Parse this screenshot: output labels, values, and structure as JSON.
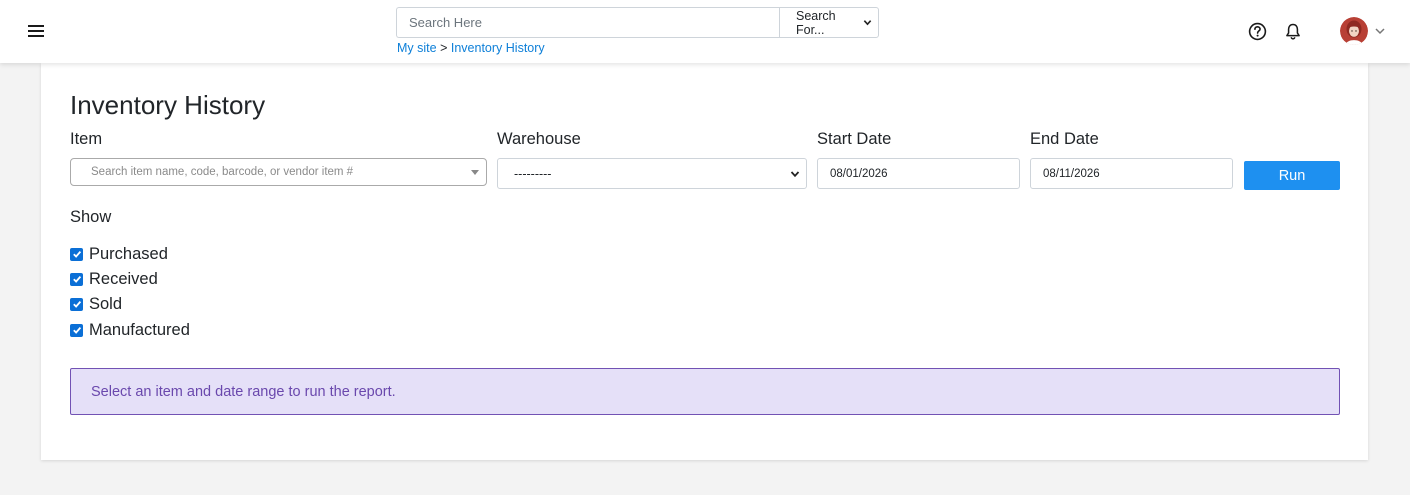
{
  "header": {
    "search": {
      "placeholder": "Search Here",
      "scope_label": "Search For..."
    },
    "breadcrumb": {
      "home": "My site",
      "separator": ">",
      "current": "Inventory History"
    },
    "icons": {
      "menu": "hamburger-menu-icon",
      "help": "help-circle-icon",
      "notifications": "bell-icon",
      "account_dropdown": "chevron-down-icon"
    }
  },
  "page": {
    "title": "Inventory History",
    "filters": {
      "item": {
        "label": "Item",
        "placeholder": "Search item name, code, barcode, or vendor item #"
      },
      "warehouse": {
        "label": "Warehouse",
        "selected": "---------"
      },
      "start_date": {
        "label": "Start Date",
        "value": "08/01/2026"
      },
      "end_date": {
        "label": "End Date",
        "value": "08/11/2026"
      },
      "run_label": "Run"
    },
    "show": {
      "label": "Show",
      "options": [
        {
          "label": "Purchased",
          "checked": true
        },
        {
          "label": "Received",
          "checked": true
        },
        {
          "label": "Sold",
          "checked": true
        },
        {
          "label": "Manufactured",
          "checked": true
        }
      ]
    },
    "message": "Select an item and date range to run the report."
  },
  "colors": {
    "accent": "#1e90f0",
    "link": "#0d7fd8",
    "checkbox": "#0b6fd6",
    "info_background": "#e5e0f8",
    "info_border": "#7252b4",
    "info_text": "#6a48ad"
  }
}
